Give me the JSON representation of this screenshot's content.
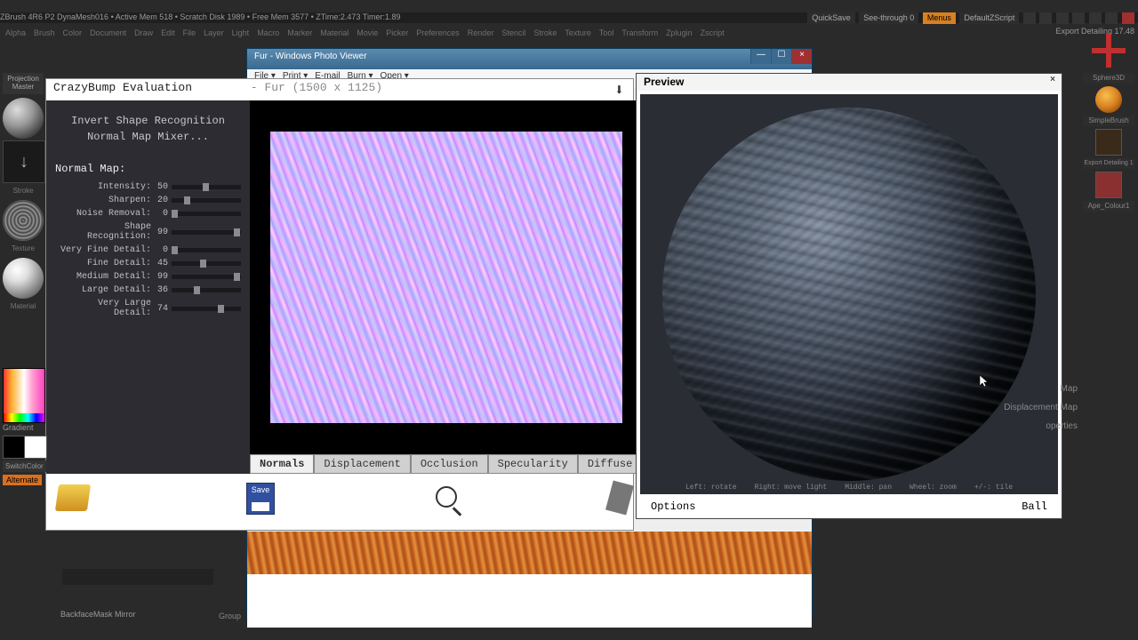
{
  "zbrush_info": "ZBrush 4R6 P2   DynaMesh016   • Active Mem 518 • Scratch Disk 1989 • Free Mem 3577 • ZTime:2.473 Timer:1.89",
  "topright": {
    "quicksave": "QuickSave",
    "seethrough": "See-through  0",
    "menus": "Menus",
    "script": "DefaultZScript",
    "export": "Export Detailing 17.48"
  },
  "menu": [
    "Alpha",
    "Brush",
    "Color",
    "Document",
    "Draw",
    "Edit",
    "File",
    "Layer",
    "Light",
    "Macro",
    "Marker",
    "Material",
    "Movie",
    "Picker",
    "Preferences",
    "Render",
    "Stencil",
    "Stroke",
    "Texture",
    "Tool",
    "Transform",
    "Zplugin",
    "Zscript"
  ],
  "pv": {
    "title": "Fur - Windows Photo Viewer",
    "menu": [
      "File  ▾",
      "Print  ▾",
      "E-mail",
      "Burn  ▾",
      "Open  ▾"
    ]
  },
  "cb": {
    "title": "CrazyBump Evaluation",
    "subtitle": "- Fur (1500 x 1125)",
    "invert": "Invert Shape Recognition",
    "mixer": "Normal Map Mixer...",
    "section": "Normal Map:",
    "sliders": [
      {
        "l": "Intensity:",
        "v": 50
      },
      {
        "l": "Sharpen:",
        "v": 20
      },
      {
        "l": "Noise Removal:",
        "v": 0
      },
      {
        "l": "Shape Recognition:",
        "v": 99
      },
      {
        "l": "Very Fine Detail:",
        "v": 0
      },
      {
        "l": "Fine Detail:",
        "v": 45
      },
      {
        "l": "Medium Detail:",
        "v": 99
      },
      {
        "l": "Large Detail:",
        "v": 36
      },
      {
        "l": "Very Large Detail:",
        "v": 74
      }
    ],
    "tabs": [
      "Normals",
      "Displacement",
      "Occlusion",
      "Specularity",
      "Diffuse"
    ],
    "save": "Save"
  },
  "preview": {
    "title": "Preview",
    "hints": [
      "Left: rotate",
      "Right: move light",
      "Middle: pan",
      "Wheel: zoom",
      "+/-: tile"
    ],
    "options": "Options",
    "mesh": "Ball"
  },
  "zr": {
    "sphere": "Sphere3D",
    "simple": "SimpleBrush",
    "detail": "Export Detailing 1",
    "ape": "Ape_Colour1"
  },
  "zside": [
    "Map",
    "Displacement Map",
    "operties"
  ],
  "left": {
    "pm": "Projection Master",
    "gradient": "Gradient",
    "switch": "SwitchColor",
    "alt": "Alternate"
  },
  "bottom": {
    "backface": "BackfaceMask Mirror",
    "group": "Group"
  }
}
